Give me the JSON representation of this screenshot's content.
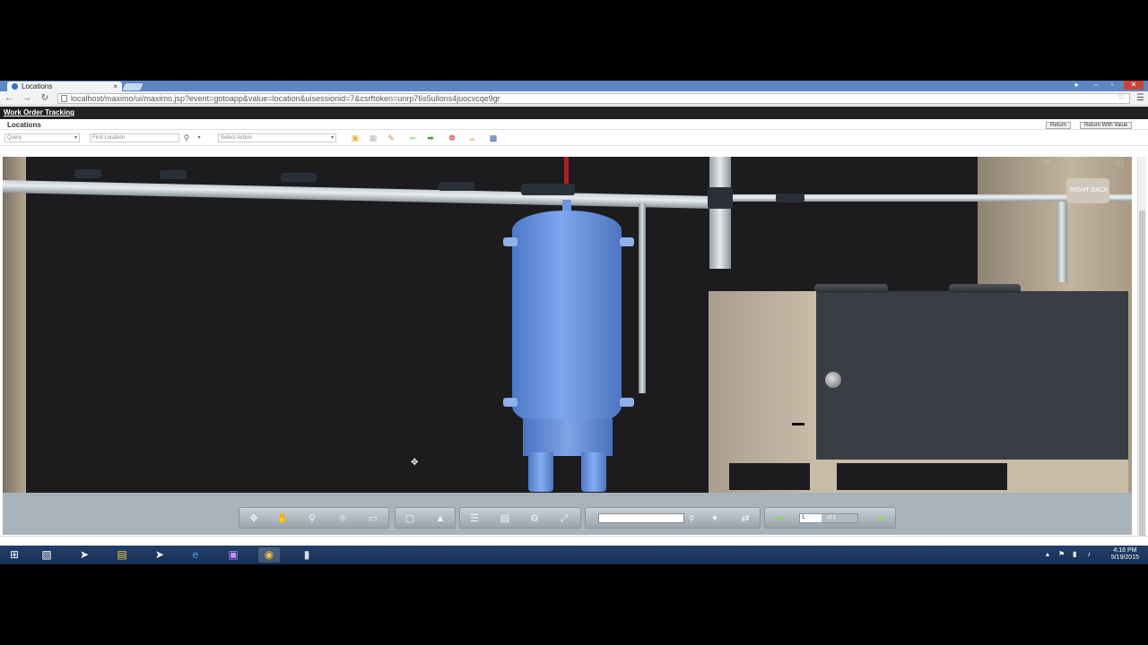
{
  "browser": {
    "tab_title": "Locations",
    "tab_close": "×",
    "url": "localhost/maximo/ui/maximo.jsp?event=gotoapp&value=location&uisessionid=7&csrftoken=unrp76s5ullons4juocvcqe9gr",
    "window_minimize": "–",
    "window_maximize": "▫",
    "window_close": "✕"
  },
  "maximo": {
    "app_link": "Work Order Tracking",
    "app_title": "Locations",
    "return_label": "Return",
    "return_with_value_label": "Return With Value",
    "query_placeholder": "Query",
    "find_location_placeholder": "Find Location",
    "select_action_placeholder": "Select Action"
  },
  "viewport": {
    "viewcube_label": "RIGHT  BACK"
  },
  "viewer_toolbar": {
    "page_value": "1",
    "page_of_label": "of 1"
  },
  "taskbar": {
    "time": "4:16 PM",
    "date": "5/19/2015"
  },
  "colors": {
    "tank_blue": "#6f96dc",
    "tab_bar": "#5d86c5",
    "taskbar": "#1d3760"
  }
}
